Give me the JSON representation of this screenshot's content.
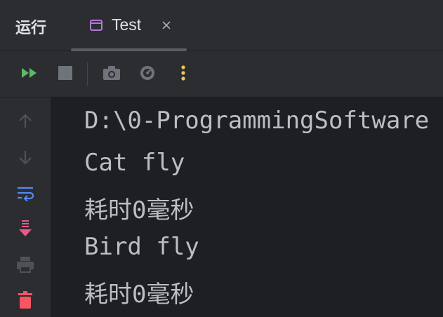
{
  "header": {
    "tool_title": "运行",
    "tab": {
      "label": "Test",
      "icon": "window-icon",
      "close_icon": "close-icon"
    }
  },
  "toolbar": {
    "buttons": [
      {
        "name": "rerun",
        "icon": "double-play-icon",
        "color": "#5fb865"
      },
      {
        "name": "stop",
        "icon": "stop-square-icon",
        "color": "#6f737a"
      },
      {
        "name": "screenshot",
        "icon": "camera-icon",
        "color": "#6f737a"
      },
      {
        "name": "profiler",
        "icon": "gauge-icon",
        "color": "#6f737a"
      },
      {
        "name": "more",
        "icon": "vertical-dots-icon",
        "color": "#f2c55c"
      }
    ]
  },
  "gutter": {
    "buttons": [
      {
        "name": "up",
        "icon": "arrow-up-icon"
      },
      {
        "name": "down",
        "icon": "arrow-down-icon"
      },
      {
        "name": "soft-wrap",
        "icon": "soft-wrap-icon",
        "color": "#548af7"
      },
      {
        "name": "scroll-to-end",
        "icon": "scroll-to-end-icon",
        "color": "#e55c8c"
      },
      {
        "name": "print",
        "icon": "printer-icon"
      },
      {
        "name": "clear",
        "icon": "trash-icon",
        "color": "#f75464"
      }
    ]
  },
  "console": {
    "lines": [
      "D:\\0-ProgrammingSoftware",
      "Cat fly",
      "耗时0毫秒",
      "Bird fly",
      "耗时0毫秒"
    ]
  }
}
